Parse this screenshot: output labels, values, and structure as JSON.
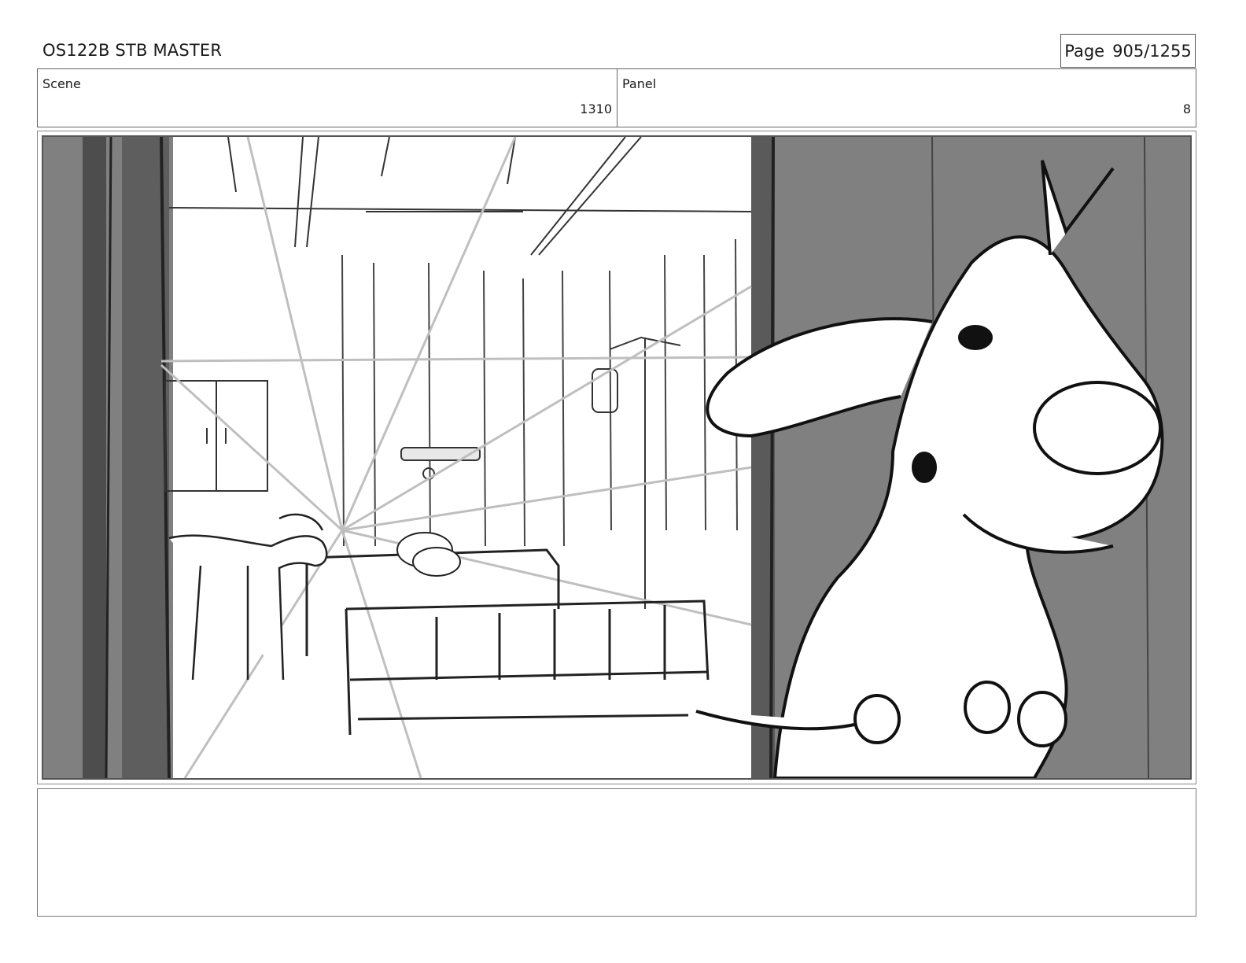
{
  "header": {
    "title": "OS122B STB MASTER",
    "page_label": "Page",
    "page_value": "905/1255"
  },
  "info": {
    "scene_label": "Scene",
    "scene_value": "1310",
    "panel_label": "Panel",
    "panel_value": "8"
  },
  "notes": {
    "text": ""
  }
}
